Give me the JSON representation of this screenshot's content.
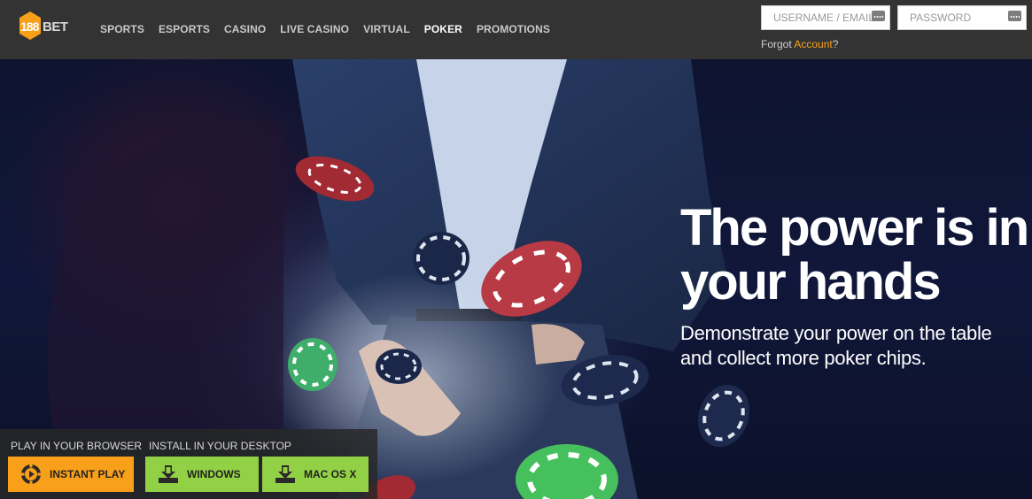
{
  "header": {
    "logo": {
      "text": "188BET"
    },
    "nav": [
      "SPORTS",
      "ESPORTS",
      "CASINO",
      "LIVE CASINO",
      "VIRTUAL",
      "POKER",
      "PROMOTIONS"
    ],
    "active_nav": "POKER",
    "username_placeholder": "USERNAME / EMAIL",
    "password_placeholder": "PASSWORD",
    "forgot_prefix": "Forgot",
    "forgot_link": "Account",
    "forgot_suffix": "?"
  },
  "hero": {
    "headline_line1": "The power is in",
    "headline_line2": "your hands",
    "subline_line1": "Demonstrate your power on the table",
    "subline_line2": "and collect more poker chips."
  },
  "download": {
    "browser_label": "PLAY IN YOUR BROWSER",
    "desktop_label": "INSTALL IN YOUR DESKTOP",
    "instant_play": "INSTANT PLAY",
    "windows": "WINDOWS",
    "mac": "MAC OS X"
  },
  "colors": {
    "brand_orange": "#f9a01b",
    "action_green": "#92d145",
    "header_bg": "#333333"
  }
}
